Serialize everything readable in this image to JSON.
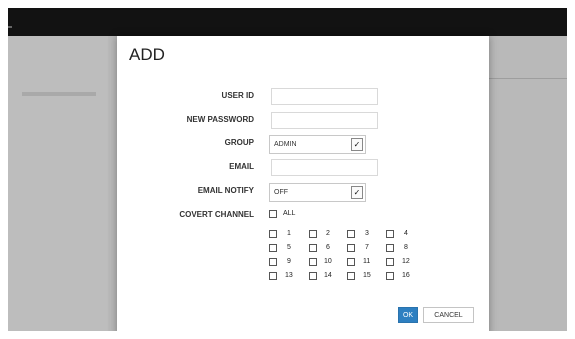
{
  "dialog": {
    "title": "ADD",
    "labels": {
      "user_id": "USER ID",
      "new_password": "NEW PASSWORD",
      "group": "GROUP",
      "email": "EMAIL",
      "email_notify": "EMAIL NOTIFY",
      "covert_channel": "COVERT CHANNEL"
    },
    "fields": {
      "user_id": "",
      "new_password": "",
      "email": ""
    },
    "group_select": {
      "value": "ADMIN"
    },
    "email_notify_select": {
      "value": "OFF"
    },
    "covert_all_label": "ALL",
    "channels": [
      "1",
      "2",
      "3",
      "4",
      "5",
      "6",
      "7",
      "8",
      "9",
      "10",
      "11",
      "12",
      "13",
      "14",
      "15",
      "16"
    ],
    "buttons": {
      "ok": "OK",
      "cancel": "CANCEL"
    }
  },
  "icons": {
    "dropdown": "chevron-down-icon"
  },
  "colors": {
    "primary_button": "#2d7fc1",
    "topbar": "#121212",
    "backdrop": "#b9b9b9"
  }
}
